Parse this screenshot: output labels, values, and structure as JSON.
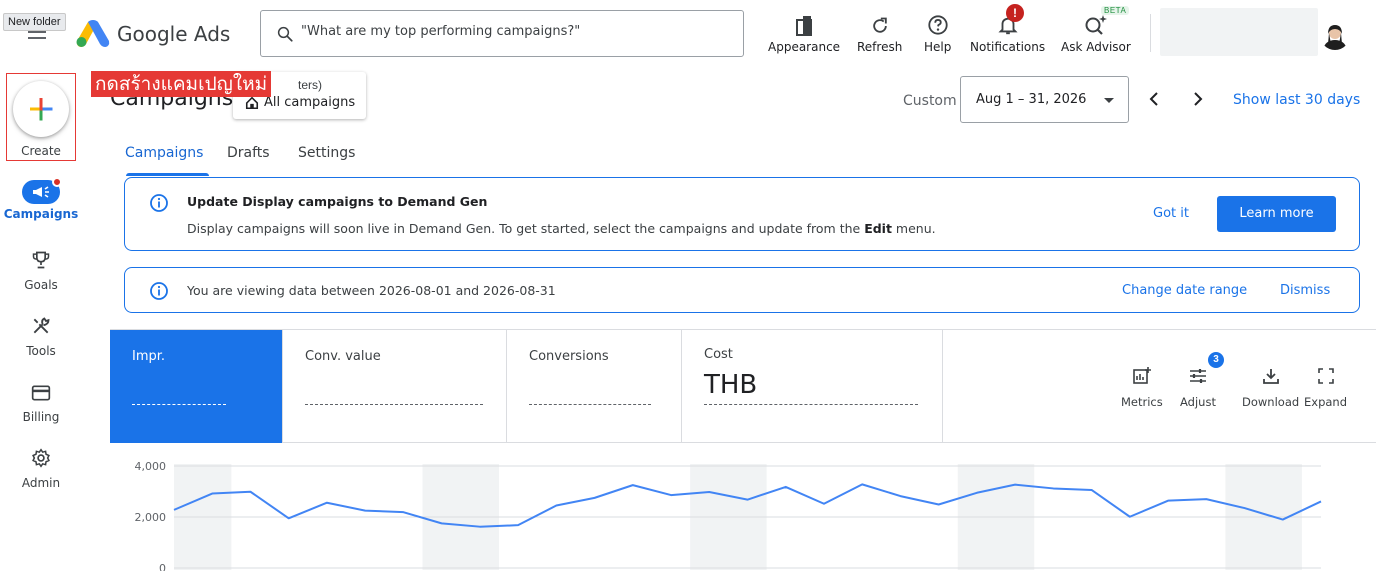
{
  "window": {
    "tooltip": "New folder"
  },
  "header": {
    "brand": "Google Ads",
    "search_placeholder": "\"What are my top performing campaigns?\"",
    "tools": [
      {
        "id": "appearance",
        "label": "Appearance",
        "icon": "appearance-icon"
      },
      {
        "id": "refresh",
        "label": "Refresh",
        "icon": "refresh-icon"
      },
      {
        "id": "help",
        "label": "Help",
        "icon": "help-icon"
      },
      {
        "id": "notifications",
        "label": "Notifications",
        "icon": "bell-icon",
        "badge": "!"
      },
      {
        "id": "ask_advisor",
        "label": "Ask Advisor",
        "icon": "advisor-icon",
        "tag": "BETA"
      }
    ]
  },
  "leftnav": {
    "create_label": "Create",
    "items": [
      {
        "label": "Campaigns",
        "icon": "campaigns-icon",
        "active": true
      },
      {
        "label": "Goals",
        "icon": "trophy-icon"
      },
      {
        "label": "Tools",
        "icon": "tools-icon"
      },
      {
        "label": "Billing",
        "icon": "billing-icon"
      },
      {
        "label": "Admin",
        "icon": "gear-icon"
      }
    ]
  },
  "annotation": {
    "text": "กดสร้างแคมเปญใหม่"
  },
  "page": {
    "title": "Campaigns",
    "filters_partial": "ters)",
    "all_campaigns": "All campaigns",
    "date": {
      "custom_label": "Custom",
      "range": "Aug 1 – 31, 2026",
      "show_last": "Show last 30 days"
    },
    "tabs": [
      "Campaigns",
      "Drafts",
      "Settings"
    ],
    "active_tab": "Campaigns"
  },
  "banners": {
    "demand_gen": {
      "title": "Update Display campaigns to Demand Gen",
      "body_before": "Display campaigns will soon live in Demand Gen. To get started, select the campaigns and update from the ",
      "body_bold": "Edit",
      "body_after": " menu.",
      "got_it": "Got it",
      "learn_more": "Learn more"
    },
    "date_notice": {
      "body": "You are viewing data between 2026-08-01 and 2026-08-31",
      "change": "Change date range",
      "dismiss": "Dismiss"
    }
  },
  "metrics": {
    "cards": [
      {
        "name": "Impr.",
        "value": "",
        "selected": true
      },
      {
        "name": "Conv. value",
        "value": ""
      },
      {
        "name": "Conversions",
        "value": ""
      },
      {
        "name": "Cost",
        "value": "THB"
      }
    ],
    "tools": [
      {
        "label": "Metrics",
        "icon": "metrics-icon"
      },
      {
        "label": "Adjust",
        "icon": "adjust-icon",
        "badge": "3"
      },
      {
        "label": "Download",
        "icon": "download-icon"
      },
      {
        "label": "Expand",
        "icon": "expand-icon"
      }
    ]
  },
  "chart_data": {
    "type": "line",
    "series_color": "#4285f4",
    "y_ticks": [
      0,
      2000,
      4000
    ],
    "y_tick_labels": [
      "0",
      "2,000",
      "4,000"
    ],
    "ylim": [
      0,
      4000
    ],
    "grid": true,
    "weekend_shading": true,
    "x": [
      1,
      2,
      3,
      4,
      5,
      6,
      7,
      8,
      9,
      10,
      11,
      12,
      13,
      14,
      15,
      16,
      17,
      18,
      19,
      20,
      21,
      22,
      23,
      24,
      25,
      26,
      27,
      28,
      29,
      30,
      31
    ],
    "values": [
      2280,
      2920,
      2990,
      1950,
      2560,
      2250,
      2190,
      1750,
      1620,
      1680,
      2450,
      2750,
      3250,
      2860,
      2980,
      2680,
      3180,
      2520,
      3280,
      2820,
      2490,
      2950,
      3270,
      3120,
      3060,
      2010,
      2640,
      2700,
      2350,
      1900,
      2610
    ]
  }
}
